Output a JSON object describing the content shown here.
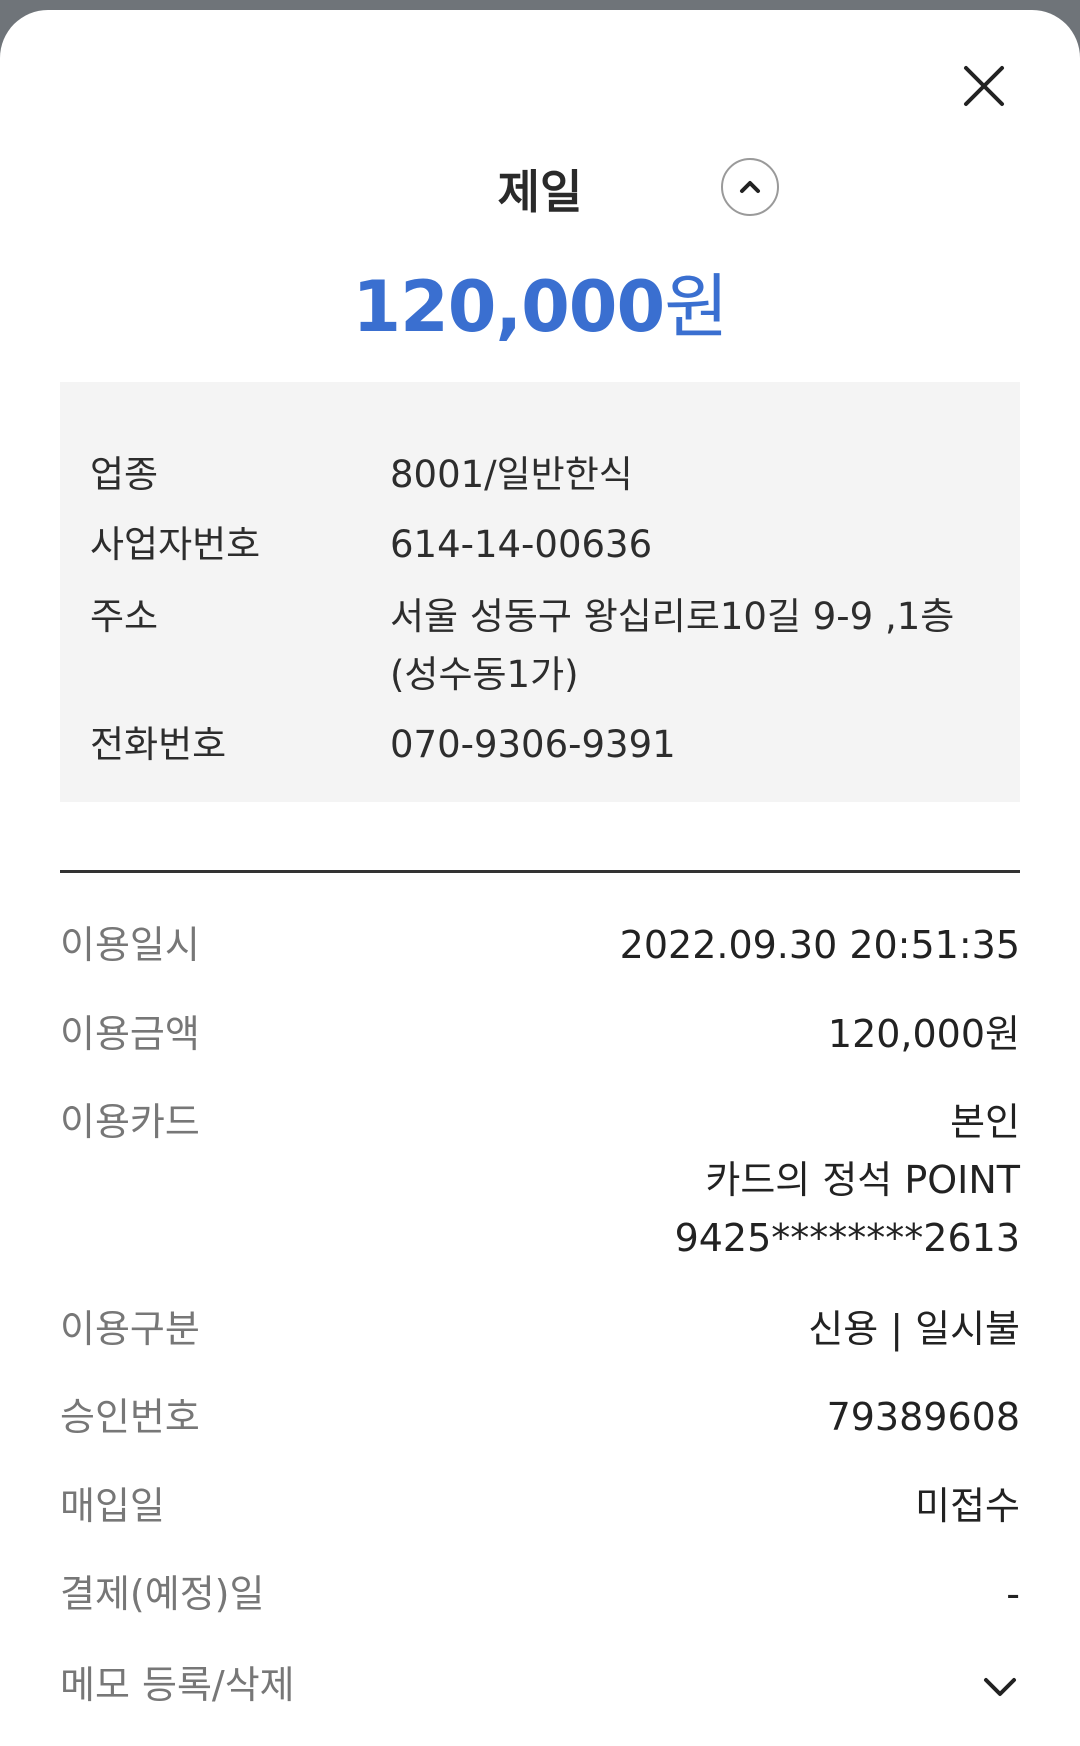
{
  "header": {
    "merchant_name": "제일",
    "amount_number": "120,000",
    "amount_unit": "원"
  },
  "merchant_info": {
    "rows": [
      {
        "label": "업종",
        "value": "8001/일반한식"
      },
      {
        "label": "사업자번호",
        "value": "614-14-00636"
      },
      {
        "label": "주소",
        "value_line1": "서울 성동구 왕십리로10길 9-9 ,1층",
        "value_line2": "(성수동1가)"
      },
      {
        "label": "전화번호",
        "value": "070-9306-9391"
      }
    ]
  },
  "details": {
    "usage_datetime": {
      "label": "이용일시",
      "value": "2022.09.30 20:51:35"
    },
    "usage_amount": {
      "label": "이용금액",
      "value": "120,000원"
    },
    "usage_card": {
      "label": "이용카드",
      "owner": "본인",
      "card_name": "카드의 정석 POINT",
      "card_number": "9425********2613"
    },
    "usage_type": {
      "label": "이용구분",
      "value": "신용 | 일시불"
    },
    "approval_number": {
      "label": "승인번호",
      "value": "79389608"
    },
    "purchase_date": {
      "label": "매입일",
      "value": "미접수"
    },
    "payment_date": {
      "label": "결제(예정)일",
      "value": "-"
    },
    "memo": {
      "label": "메모 등록/삭제"
    }
  },
  "icons": {
    "close": "close-icon",
    "collapse": "chevron-up-icon",
    "memo_expand": "chevron-down-icon"
  },
  "colors": {
    "accent_amount": "#3a6fd0",
    "info_box_bg": "#f4f4f4",
    "label_gray": "#777777"
  }
}
